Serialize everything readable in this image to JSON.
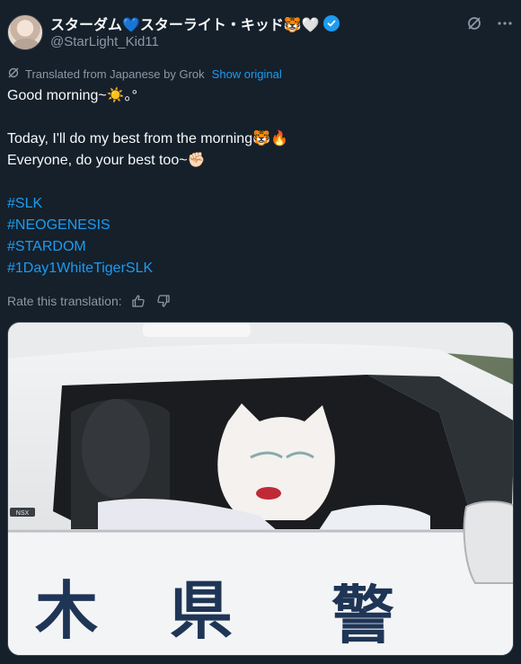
{
  "author": {
    "display_name": "スターダム💙スターライト・キッド🐯🤍",
    "handle": "@StarLight_Kid11",
    "verified": true
  },
  "header_icons": [
    "grok-icon",
    "more-icon"
  ],
  "translation": {
    "label": "Translated from Japanese by Grok",
    "show_original": "Show original"
  },
  "tweet": {
    "line1": "Good morning~☀️｡°",
    "line2": "Today, I'll do my best from the morning🐯🔥",
    "line3": "Everyone, do your best too~✊🏻",
    "hashtags": [
      "#SLK",
      "#NEOGENESIS",
      "#STARDOM",
      "#1Day1WhiteTigerSLK"
    ]
  },
  "rate": {
    "label": "Rate this translation:"
  },
  "media": {
    "car_badge": "NSX",
    "door_text": [
      "木",
      "県",
      "警"
    ]
  },
  "colors": {
    "background": "#15202b",
    "accent": "#1d9bf0",
    "muted": "#8b98a5"
  }
}
